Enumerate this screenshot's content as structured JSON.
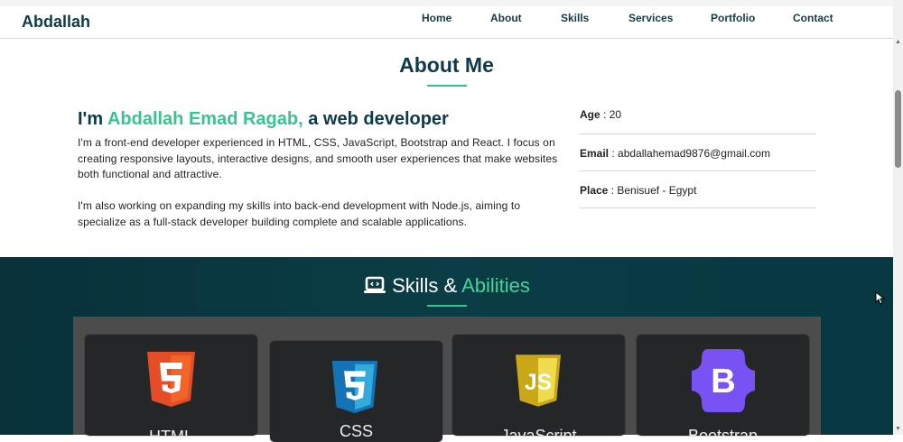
{
  "header": {
    "brand": "Abdallah",
    "nav": [
      {
        "label": "Home"
      },
      {
        "label": "About"
      },
      {
        "label": "Skills"
      },
      {
        "label": "Services"
      },
      {
        "label": "Portfolio"
      },
      {
        "label": "Contact"
      }
    ]
  },
  "about": {
    "title": "About Me",
    "intro_prefix": "I'm",
    "name": "Abdallah Emad Ragab,",
    "intro_suffix": "a web developer",
    "paragraph_1": "I'm a front-end developer experienced in HTML, CSS, JavaScript, Bootstrap and React. I focus on creating responsive layouts, interactive designs, and smooth user experiences that make websites both functional and attractive.",
    "paragraph_2": "I'm also working on expanding my skills into back-end development with Node.js, aiming to specialize as a full-stack developer building complete and scalable applications.",
    "info": [
      {
        "label": "Age",
        "value": "20"
      },
      {
        "label": "Email",
        "value": "abdallahemad9876@gmail.com"
      },
      {
        "label": "Place",
        "value": "Benisuef - Egypt"
      }
    ]
  },
  "skills": {
    "title_prefix": "Skills &",
    "title_accent": "Abilities",
    "icon": "laptop-code-icon",
    "cards": [
      {
        "name": "HTML",
        "icon": "html5-icon",
        "color": "#e44d26"
      },
      {
        "name": "CSS",
        "icon": "css3-icon",
        "color": "#1572b6"
      },
      {
        "name": "JavaScript",
        "icon": "javascript-icon",
        "color": "#f0db4f"
      },
      {
        "name": "Bootstrap",
        "icon": "bootstrap-icon",
        "color": "#7952f3"
      }
    ]
  },
  "colors": {
    "primary": "#0d3b47",
    "accent": "#39c48f",
    "skills_bg": "#0a3d45"
  }
}
